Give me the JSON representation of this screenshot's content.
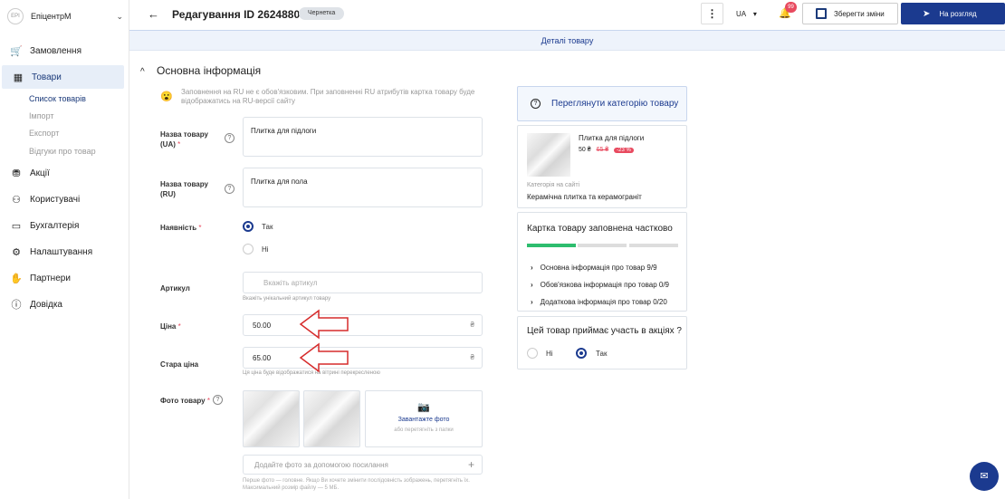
{
  "sidebar": {
    "brand": "ЕпіцентрМ",
    "logo_text": "EPI",
    "items": [
      {
        "label": "Замовлення",
        "icon": "cart-icon"
      },
      {
        "label": "Товари",
        "icon": "products-icon"
      },
      {
        "label": "Акції",
        "icon": "promo-icon"
      },
      {
        "label": "Користувачі",
        "icon": "users-icon"
      },
      {
        "label": "Бухгалтерія",
        "icon": "wallet-icon"
      },
      {
        "label": "Налаштування",
        "icon": "gear-icon"
      },
      {
        "label": "Партнери",
        "icon": "handshake-icon"
      },
      {
        "label": "Довідка",
        "icon": "help-icon"
      }
    ],
    "sub_items": [
      "Список товарів",
      "Імпорт",
      "Експорт",
      "Відгуки про товар"
    ]
  },
  "header": {
    "title": "Редагування ID 26248808",
    "status": "Чернетка",
    "lang": "UA",
    "notif_count": "99",
    "save_label": "Зберегти зміни",
    "review_label": "На розгляд"
  },
  "tab": "Деталі товару",
  "section": {
    "title": "Основна інформація",
    "note": "Заповнення на RU не є обов'язковим. При заповненні RU атрибутів картка товару буде відображатись на RU-версії сайту"
  },
  "form": {
    "name_ua_label": "Назва товару (UA)",
    "name_ua_value": "Плитка для підлоги",
    "name_ru_label": "Назва товару (RU)",
    "name_ru_value": "Плитка для пола",
    "availability_label": "Наявність",
    "yes": "Так",
    "no": "Ні",
    "sku_label": "Артикул",
    "sku_placeholder": "Вкажіть артикул",
    "sku_hint": "Вкажіть унікальний артикул товару",
    "price_label": "Ціна",
    "price_value": "50.00",
    "old_price_label": "Стара ціна",
    "old_price_value": "65.00",
    "old_price_hint": "Ця ціна буде відображатися на вітрині перекресленою",
    "currency": "₴",
    "photo_label": "Фото товару",
    "upload_title": "Завантажте фото",
    "upload_sub": "або перетягніть з папки",
    "url_placeholder": "Додайте фото за допомогою посилання",
    "footnote": "Перше фото — головне. Якщо Ви хочете змінити послідовність зображень, перетягніть їх. Максимальний розмір файлу — 5 МБ."
  },
  "right": {
    "view_category": "Переглянути категорію товару",
    "product_name": "Плитка для підлоги",
    "price": "50 ₴",
    "old_price": "65 ₴",
    "discount": "-23 %",
    "category_label": "Категорія на сайті",
    "category_value": "Керамічна плитка та керамограніт",
    "fill_title": "Картка товару заповнена частково",
    "fill_progress": [
      1,
      0,
      0
    ],
    "fill_rows": [
      {
        "label": "Основна інформація про товар 9/9"
      },
      {
        "label": "Обов'язкова інформація про товар 0/9"
      },
      {
        "label": "Додаткова інформація про товар 0/20"
      }
    ],
    "promo_title": "Цей товар приймає участь в акціях ?",
    "promo_no": "Ні",
    "promo_yes": "Так"
  },
  "colors": {
    "accent": "#1b3a8f",
    "progress": "#2dbd6e",
    "danger": "#e84a5f"
  }
}
